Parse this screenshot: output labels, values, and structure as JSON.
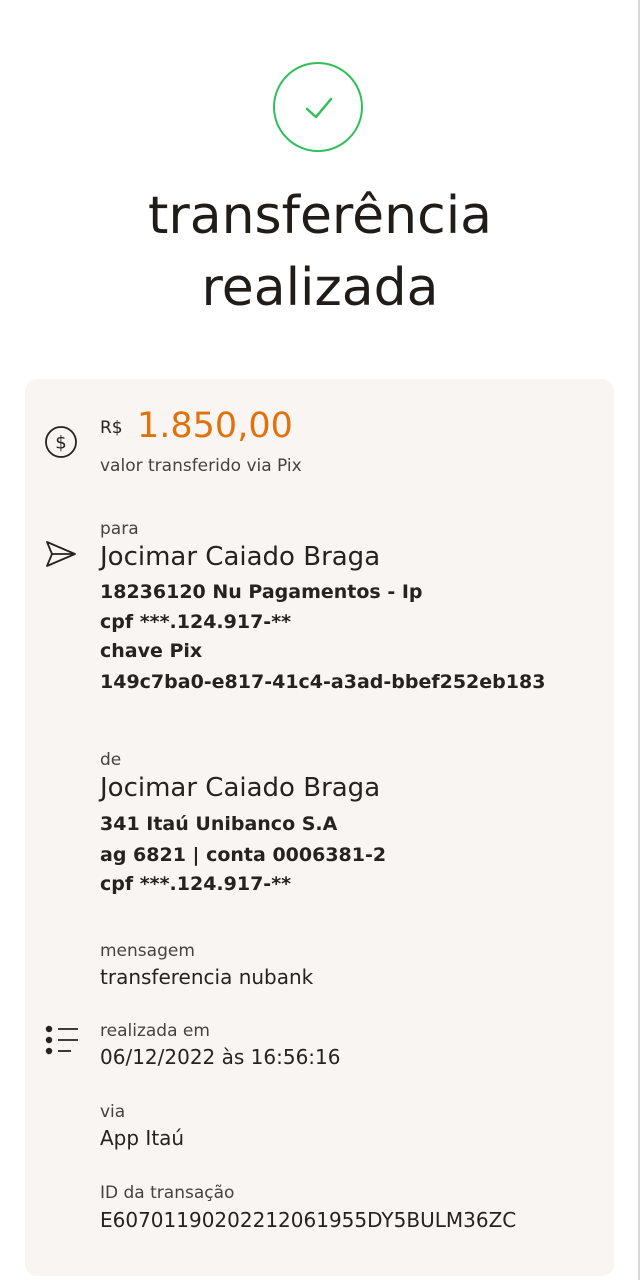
{
  "status": {
    "icon": "check-circle-icon",
    "title_line1": "transferência",
    "title_line2": "realizada"
  },
  "amount": {
    "icon": "dollar-circle-icon",
    "currency": "R$",
    "value": "1.850,00",
    "description": "valor transferido via Pix"
  },
  "to": {
    "icon": "send-icon",
    "label": "para",
    "name": "Jocimar Caiado Braga",
    "bank": "18236120 Nu Pagamentos - Ip",
    "cpf": "cpf ***.124.917-**",
    "pix_label": "chave Pix",
    "pix_key": "149c7ba0-e817-41c4-a3ad-bbef252eb183"
  },
  "from": {
    "label": "de",
    "name": "Jocimar Caiado Braga",
    "bank": "341 Itaú Unibanco S.A",
    "account": "ag 6821 | conta 0006381-2",
    "cpf": "cpf ***.124.917-**"
  },
  "message": {
    "label": "mensagem",
    "value": "transferencia nubank"
  },
  "details": {
    "icon": "list-icon",
    "date_label": "realizada em",
    "date_value": "06/12/2022 às 16:56:16",
    "via_label": "via",
    "via_value": "App Itaú",
    "id_label": "ID da transação",
    "id_value": "E60701190202212061955DY5BULM36ZC"
  },
  "colors": {
    "success": "#2fc05a",
    "amount": "#e0720d",
    "card_bg": "#f8f5f2"
  }
}
